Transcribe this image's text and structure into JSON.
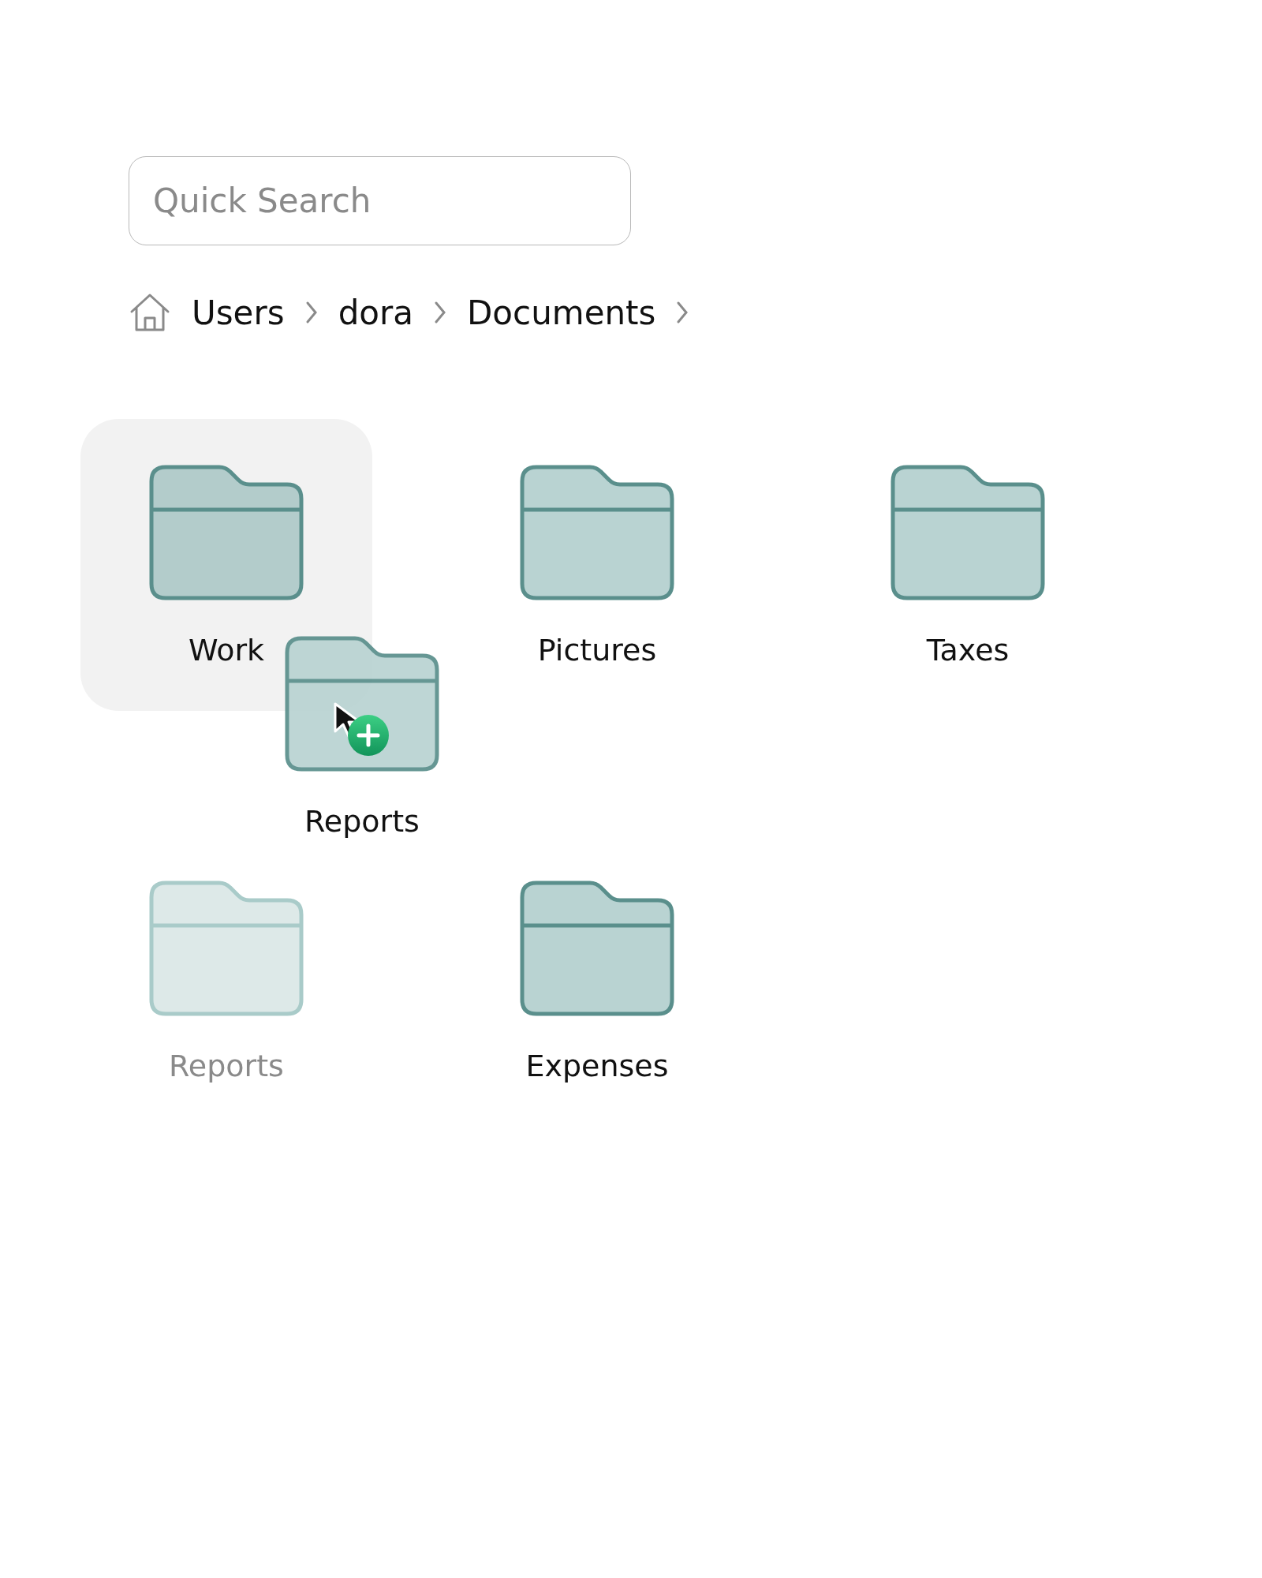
{
  "search": {
    "placeholder": "Quick Search"
  },
  "breadcrumb": [
    "Users",
    "dora",
    "Documents"
  ],
  "folders": [
    {
      "label": "Work",
      "selected": true,
      "dimmed": false
    },
    {
      "label": "Pictures",
      "selected": false,
      "dimmed": false
    },
    {
      "label": "Taxes",
      "selected": false,
      "dimmed": false
    },
    {
      "label": "Reports",
      "selected": false,
      "dimmed": true
    },
    {
      "label": "Expenses",
      "selected": false,
      "dimmed": false
    }
  ],
  "dragged": {
    "label": "Reports"
  }
}
